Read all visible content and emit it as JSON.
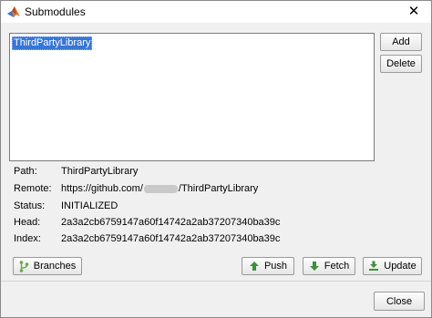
{
  "window": {
    "title": "Submodules"
  },
  "list": {
    "items": [
      "ThirdPartyLibrary"
    ]
  },
  "side_buttons": {
    "add": "Add",
    "delete": "Delete"
  },
  "info": {
    "path_label": "Path:",
    "path_value": "ThirdPartyLibrary",
    "remote_label": "Remote:",
    "remote_prefix": "https://github.com/",
    "remote_suffix": "/ThirdPartyLibrary",
    "status_label": "Status:",
    "status_value": "INITIALIZED",
    "head_label": "Head:",
    "head_value": "2a3a2cb6759147a60f14742a2ab37207340ba39c",
    "index_label": "Index:",
    "index_value": "2a3a2cb6759147a60f14742a2ab37207340ba39c"
  },
  "actions": {
    "branches": "Branches",
    "push": "Push",
    "fetch": "Fetch",
    "update": "Update"
  },
  "footer": {
    "close": "Close"
  },
  "colors": {
    "selection": "#3875d6",
    "branch_icon": "#6aa84f",
    "arrow_icon": "#3f8f3f"
  }
}
